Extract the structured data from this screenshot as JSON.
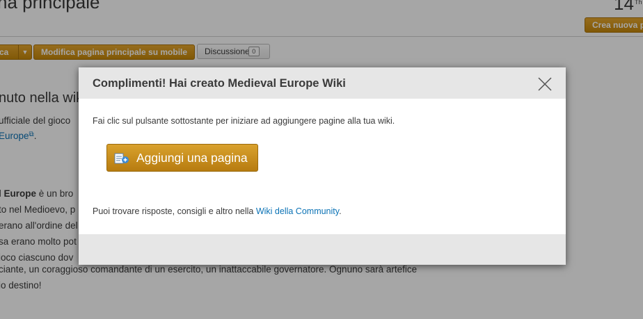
{
  "page": {
    "title": "na principale",
    "count": "14",
    "count_sup": "Th",
    "create_label": "Crea nuova p"
  },
  "toolbar": {
    "edit_label": "ca",
    "mobile_label": "Modifica pagina principale su mobile",
    "discussion_label": "Discussione",
    "discussion_count": "0"
  },
  "content": {
    "heading": "nuto nella wik",
    "line1": "ufficiale del gioco",
    "line2_link": "Europe",
    "line2_after": ".",
    "line3_bold": "l Europe",
    "line3_rest": " è un bro",
    "line4": "to nel Medioevo, p",
    "line5": "erano all'ordine del",
    "line6": "sa erano molto pot",
    "line7": "ioco ciascuno dov",
    "line8": "ciante, un coraggioso comandante di un esercito, un inattaccabile governatore. Ognuno sarà artefice",
    "line9": "io destino!"
  },
  "modal": {
    "title": "Complimenti! Hai creato Medieval Europe Wiki",
    "instruction": "Fai clic sul pulsante sottostante per iniziare ad aggiungere pagine alla tua wiki.",
    "add_page_label": "Aggiungi una pagina",
    "footer_text": "Puoi trovare risposte, consigli e altro nella ",
    "footer_link": "Wiki della Community",
    "footer_end": "."
  },
  "colors": {
    "accent": "#c6880b",
    "link": "#0b72b5"
  }
}
